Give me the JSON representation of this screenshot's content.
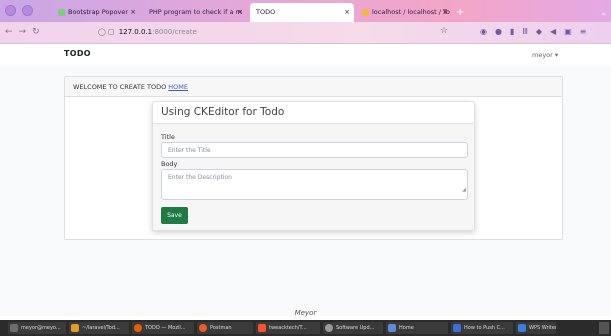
{
  "browser": {
    "tabs": [
      {
        "label": "Bootstrap Popover",
        "color": "#f28b8b"
      },
      {
        "label": "PHP program to check if a m",
        "color": "#c6c6c6"
      },
      {
        "label": "TODO",
        "color": "#ffffff"
      },
      {
        "label": "localhost / localhost / To",
        "color": "#f5b642"
      }
    ],
    "url_host": "127.0.0.1",
    "url_path": ":8000/create"
  },
  "app": {
    "brand": "TODO",
    "user_menu": "meyor"
  },
  "card": {
    "header_text": "WELCOME TO CREATE TODO",
    "header_link": "HOME"
  },
  "form": {
    "title": "Using CKEditor for Todo",
    "title_label": "Title",
    "title_placeholder": "Enter the Title",
    "body_label": "Body",
    "body_placeholder": "Enter the Description",
    "save_label": "Save"
  },
  "footer": {
    "text": "Meyor"
  },
  "taskbar": {
    "items": [
      {
        "label": "meyor@meyo...",
        "color": "#6c6c6c"
      },
      {
        "label": "~/laravel/Tod...",
        "color": "#e69a28"
      },
      {
        "label": "TODO — Mozil...",
        "color": "#e66000"
      },
      {
        "label": "Postman",
        "color": "#ef5b25"
      },
      {
        "label": "tweacktech/T...",
        "color": "#fb542b"
      },
      {
        "label": "Software Upd...",
        "color": "#9a9a9a"
      },
      {
        "label": "Home",
        "color": "#5b8bd9"
      },
      {
        "label": "How to Push C...",
        "color": "#3a6fd8"
      },
      {
        "label": "WPS Writer",
        "color": "#3b7ddd"
      }
    ]
  }
}
